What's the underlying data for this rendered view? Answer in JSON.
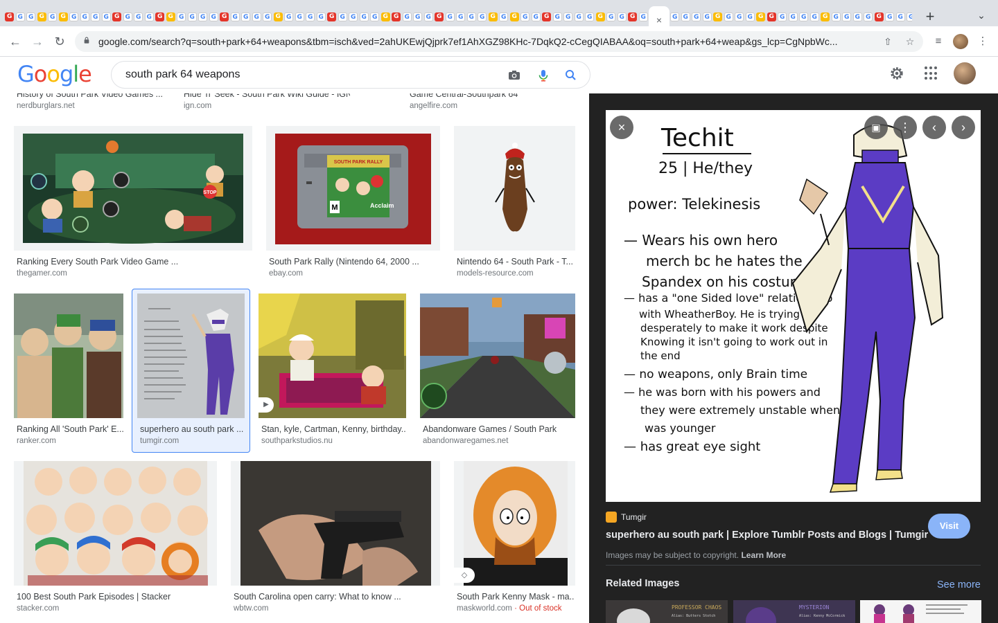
{
  "browser": {
    "active_tab_close": "×",
    "new_tab": "+",
    "url_domain": "google.com",
    "url_rest": "/search?q=south+park+64+weapons&tbm=isch&ved=2ahUKEwjQjprk7ef1AhXGZ98KHc-7DqkQ2-cCegQIABAA&oq=south+park+64+weap&gs_lcp=CgNpbWc..."
  },
  "google": {
    "logo": "Google",
    "query": "south park 64 weapons"
  },
  "top_row": [
    {
      "title": "History of South Park Video Games ...",
      "source": "nerdburglars.net"
    },
    {
      "title": "Hide 'n' Seek - South Park Wiki Guide - IGN",
      "source": "ign.com"
    },
    {
      "title": "Game Central-Southpark 64",
      "source": "angelfire.com"
    }
  ],
  "results": [
    {
      "title": "Ranking Every South Park Video Game ...",
      "source": "thegamer.com"
    },
    {
      "title": "South Park Rally (Nintendo 64, 2000 ...",
      "source": "ebay.com"
    },
    {
      "title": "Nintendo 64 - South Park - T...",
      "source": "models-resource.com"
    },
    {
      "title": "Ranking All 'South Park' E...",
      "source": "ranker.com"
    },
    {
      "title": "superhero au south park ...",
      "source": "tumgir.com"
    },
    {
      "title": "Stan, kyle, Cartman, Kenny, birthday...",
      "source": "southparkstudios.nu"
    },
    {
      "title": "Abandonware Games / South Park",
      "source": "abandonwaregames.net"
    },
    {
      "title": "100 Best South Park Episodes | Stacker",
      "source": "stacker.com"
    },
    {
      "title": "South Carolina open carry: What to know ...",
      "source": "wbtw.com"
    },
    {
      "title": "South Park Kenny Mask - ma...",
      "source": "maskworld.com",
      "extra": "· Out of stock"
    }
  ],
  "thumb_text": {
    "stop_sign": "STOP",
    "cartridge_label": "SOUTH PARK RALLY",
    "cartridge_brand": "Acclaim",
    "rating": "M"
  },
  "preview": {
    "close": "×",
    "prev": "‹",
    "next": "›",
    "more": "⋮",
    "note_lines": [
      "Techit",
      "25 | He/they",
      "power: Telekinesis",
      "— Wears his own hero",
      "merch bc he hates the",
      "Spandex on his costume",
      "— has a \"one Sided love\" relationship",
      "with WheatherBoy. He is trying",
      "desperately to make it work despite",
      "Knowing it isn't going to work out in",
      "the end",
      "— no weapons, only Brain time",
      "— he was born with his powers and",
      "they were extremely unstable when he",
      "was younger",
      "— has great eye sight"
    ],
    "source": "Tumgir",
    "title": "superhero au south park | Explore Tumblr Posts and Blogs | Tumgir",
    "visit": "Visit",
    "copyright": "Images may be subject to copyright.",
    "learn_more": "Learn More",
    "related": "Related Images",
    "see_more": "See more",
    "related_thumbs": [
      {
        "title": "PROFESSOR CHAOS",
        "lines": "Alias: Butters Stotch"
      },
      {
        "title": "MYSTERION",
        "lines": "Alias: Kenny McCormick"
      }
    ]
  },
  "colors": {
    "selection": "#4285f4",
    "panel_bg": "#222222",
    "link": "#8ab4f8",
    "stock_red": "#d93025"
  }
}
